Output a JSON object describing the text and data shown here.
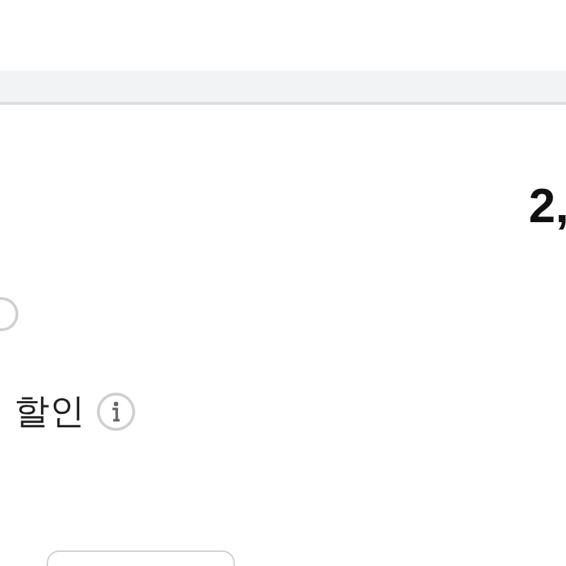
{
  "price": {
    "amount": "2,"
  },
  "option": {
    "checked": false
  },
  "discount": {
    "label": "할인"
  },
  "bottom_control": {
    "kind": "outline"
  }
}
